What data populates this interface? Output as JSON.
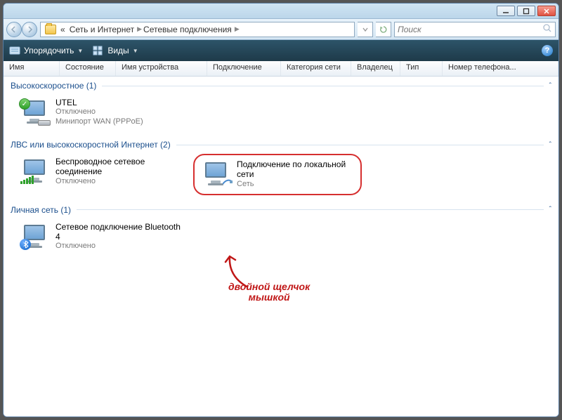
{
  "titlebar": {
    "min": "",
    "max": "",
    "close": ""
  },
  "address": {
    "crumb0": "«",
    "crumb1": "Сеть и Интернет",
    "crumb2": "Сетевые подключения",
    "search_placeholder": "Поиск"
  },
  "toolbar": {
    "organize": "Упорядочить",
    "views": "Виды",
    "help": "?"
  },
  "columns": {
    "c0": "Имя",
    "c1": "Состояние",
    "c2": "Имя устройства",
    "c3": "Подключение",
    "c4": "Категория сети",
    "c5": "Владелец",
    "c6": "Тип",
    "c7": "Номер телефона..."
  },
  "groups": {
    "g1": {
      "title": "Высокоскоростное (1)"
    },
    "g2": {
      "title": "ЛВС или высокоскоростной Интернет (2)"
    },
    "g3": {
      "title": "Личная сеть (1)"
    }
  },
  "items": {
    "i1": {
      "name": "UTEL",
      "status": "Отключено",
      "device": "Минипорт WAN (PPPoE)"
    },
    "i2": {
      "name": "Беспроводное сетевое соединение",
      "status": "Отключено",
      "device": ""
    },
    "i3": {
      "name": "Подключение по локальной сети",
      "status": "Сеть",
      "device": ""
    },
    "i4": {
      "name": "Сетевое подключение Bluetooth 4",
      "status": "Отключено",
      "device": ""
    }
  },
  "annotation": {
    "line1": "двойной щелчок",
    "line2": "мышкой"
  }
}
